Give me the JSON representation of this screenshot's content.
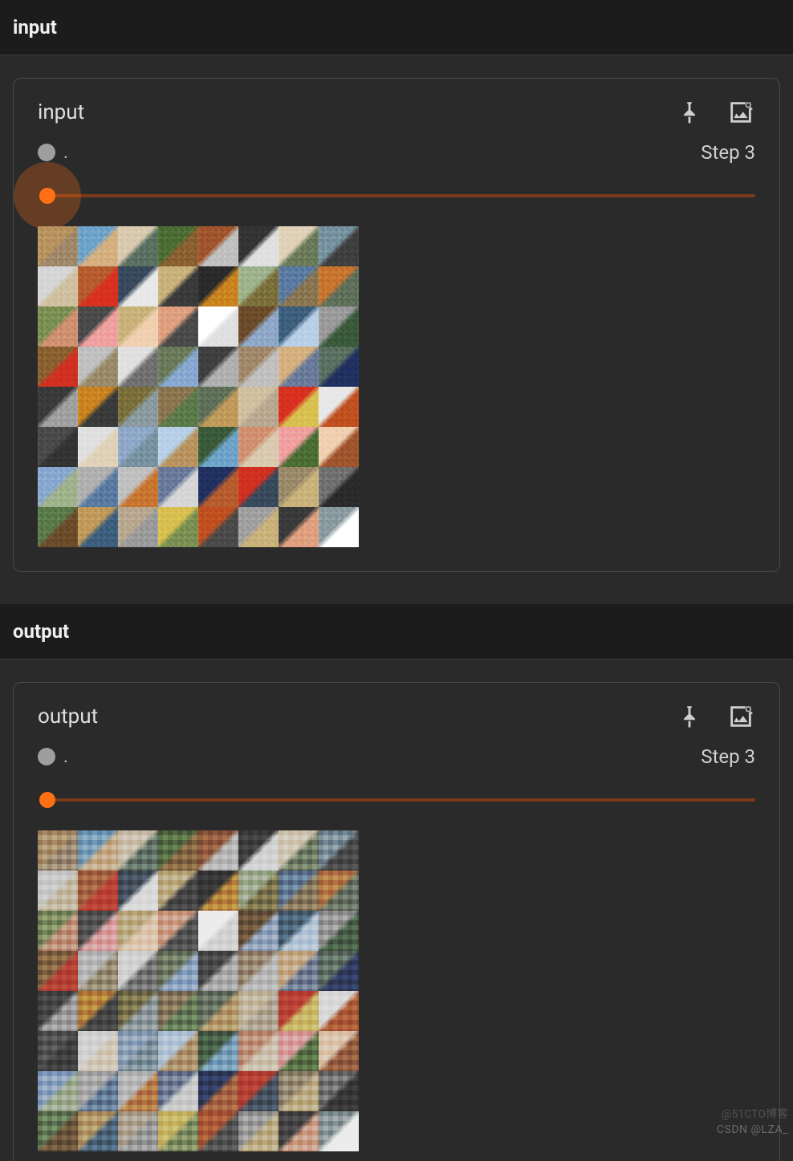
{
  "sections": [
    {
      "header": "input",
      "card": {
        "title": "input",
        "run_dot_label": ".",
        "step_label": "Step 3",
        "grid_rows": 8,
        "grid_cols": 8,
        "pixelated": false
      }
    },
    {
      "header": "output",
      "card": {
        "title": "output",
        "run_dot_label": ".",
        "step_label": "Step 3",
        "grid_rows": 8,
        "grid_cols": 8,
        "pixelated": true
      }
    }
  ],
  "icons": {
    "pin": "pin-icon",
    "image_detail": "image-detail-icon"
  },
  "accent_color": "#ff7014",
  "watermark_faint": "@51CTO博客",
  "watermark": "CSDN @LZA_"
}
